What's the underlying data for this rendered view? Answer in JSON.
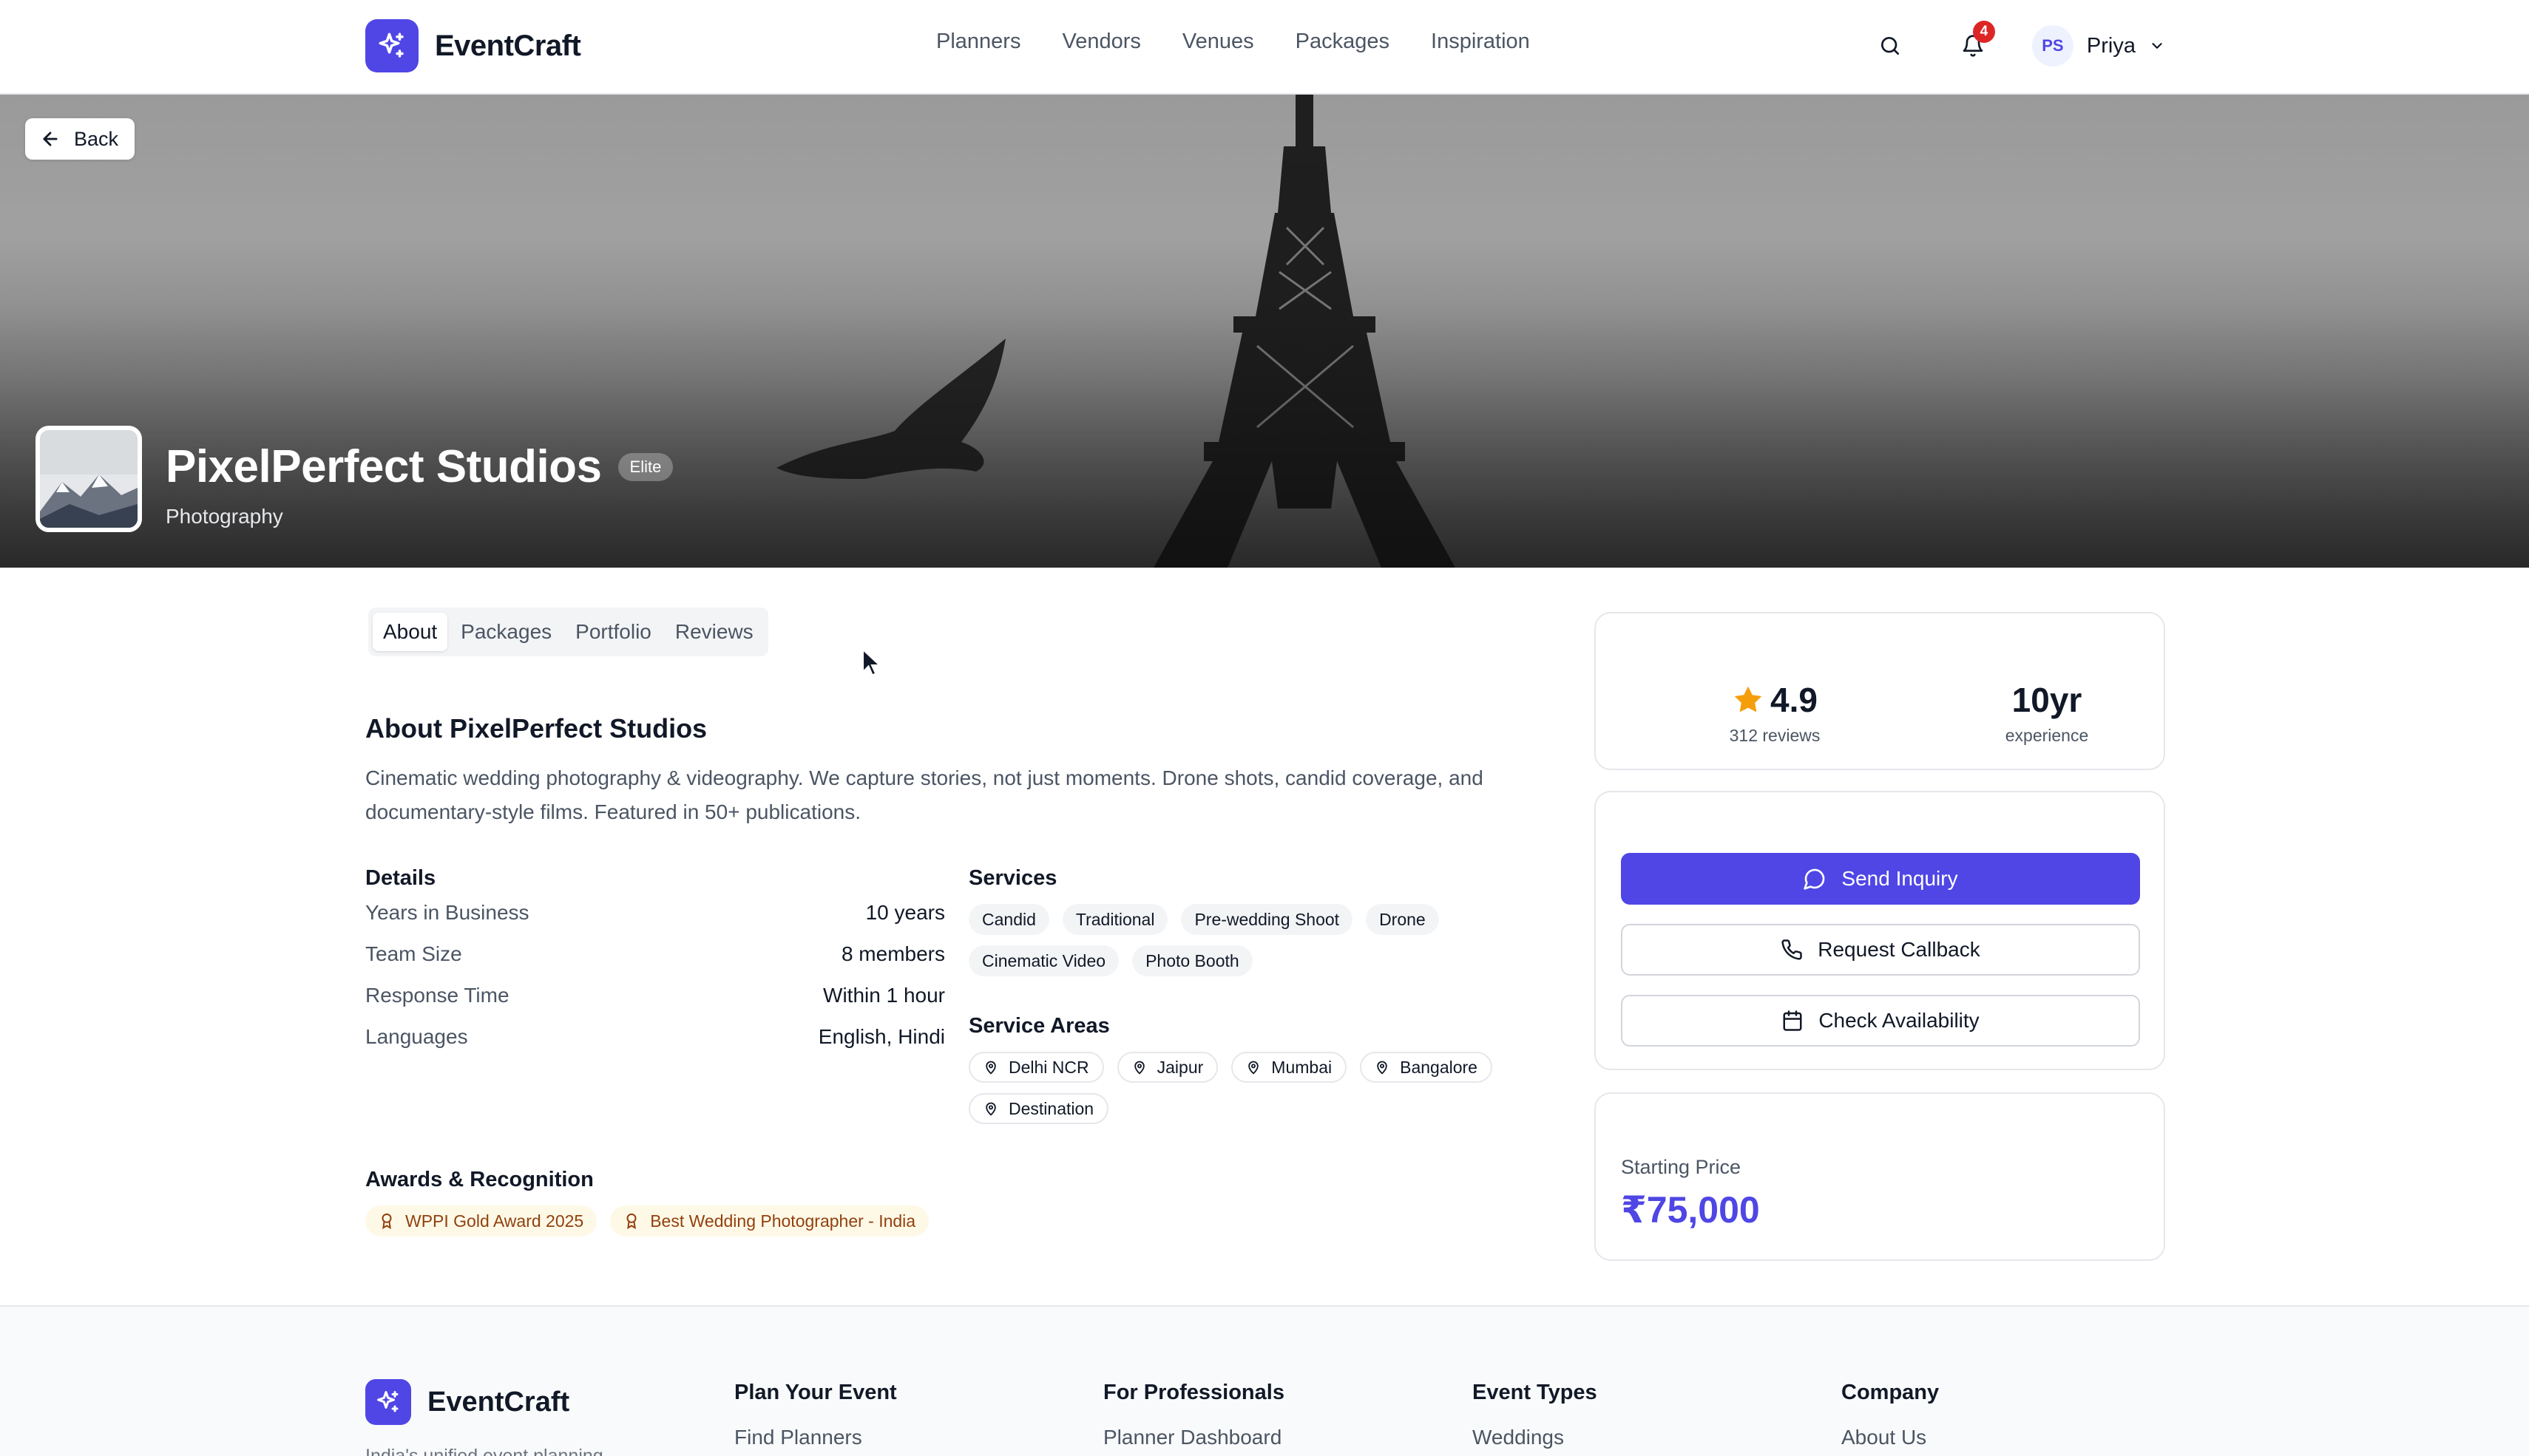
{
  "brand": {
    "name": "EventCraft"
  },
  "nav": {
    "links": [
      "Planners",
      "Vendors",
      "Venues",
      "Packages",
      "Inspiration"
    ],
    "notification_count": "4",
    "user_initials": "PS",
    "user_name": "Priya"
  },
  "hero": {
    "back_label": "Back",
    "vendor_name": "PixelPerfect Studios",
    "tier_badge": "Elite",
    "category": "Photography"
  },
  "tabs": [
    "About",
    "Packages",
    "Portfolio",
    "Reviews"
  ],
  "about": {
    "title": "About PixelPerfect Studios",
    "description": "Cinematic wedding photography & videography. We capture stories, not just moments. Drone shots, candid coverage, and documentary-style films. Featured in 50+ publications."
  },
  "details": {
    "heading": "Details",
    "rows": [
      {
        "label": "Years in Business",
        "value": "10 years"
      },
      {
        "label": "Team Size",
        "value": "8 members"
      },
      {
        "label": "Response Time",
        "value": "Within 1 hour"
      },
      {
        "label": "Languages",
        "value": "English, Hindi"
      }
    ]
  },
  "services": {
    "heading": "Services",
    "items": [
      "Candid",
      "Traditional",
      "Pre-wedding Shoot",
      "Drone",
      "Cinematic Video",
      "Photo Booth"
    ]
  },
  "service_areas": {
    "heading": "Service Areas",
    "items": [
      "Delhi NCR",
      "Jaipur",
      "Mumbai",
      "Bangalore",
      "Destination"
    ]
  },
  "awards": {
    "heading": "Awards & Recognition",
    "items": [
      "WPPI Gold Award 2025",
      "Best Wedding Photographer - India"
    ]
  },
  "stats": {
    "rating": "4.9",
    "reviews_label": "312 reviews",
    "experience": "10yr",
    "experience_label": "experience"
  },
  "actions": {
    "send_inquiry": "Send Inquiry",
    "request_callback": "Request Callback",
    "check_availability": "Check Availability"
  },
  "price": {
    "label": "Starting Price",
    "value": "₹75,000"
  },
  "footer": {
    "brand": "EventCraft",
    "tagline": "India's unified event planning",
    "columns": [
      {
        "heading": "Plan Your Event",
        "first_link": "Find Planners"
      },
      {
        "heading": "For Professionals",
        "first_link": "Planner Dashboard"
      },
      {
        "heading": "Event Types",
        "first_link": "Weddings"
      },
      {
        "heading": "Company",
        "first_link": "About Us"
      }
    ]
  },
  "colors": {
    "accent": "#4f46e5",
    "star": "#f59e0b",
    "award_text": "#92400e",
    "notification": "#dc2626"
  }
}
